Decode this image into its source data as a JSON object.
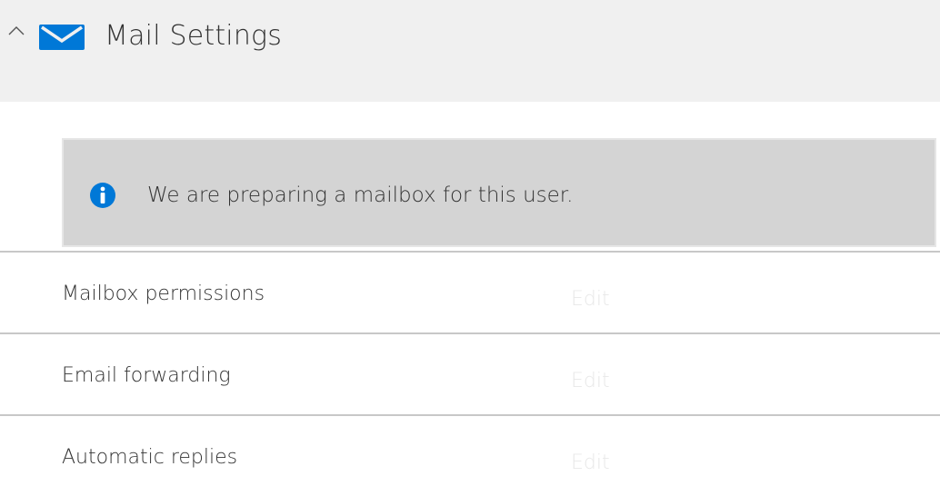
{
  "header": {
    "title": "Mail Settings",
    "collapse_icon": "chevron-up-icon",
    "mail_icon": "envelope-icon",
    "accent_color": "#0078d7"
  },
  "notice": {
    "icon": "info-icon",
    "message": "We are preparing a mailbox for this user."
  },
  "settings": [
    {
      "label": "Mailbox permissions",
      "action": "Edit"
    },
    {
      "label": "Email forwarding",
      "action": "Edit"
    },
    {
      "label": "Automatic replies",
      "action": "Edit"
    }
  ]
}
